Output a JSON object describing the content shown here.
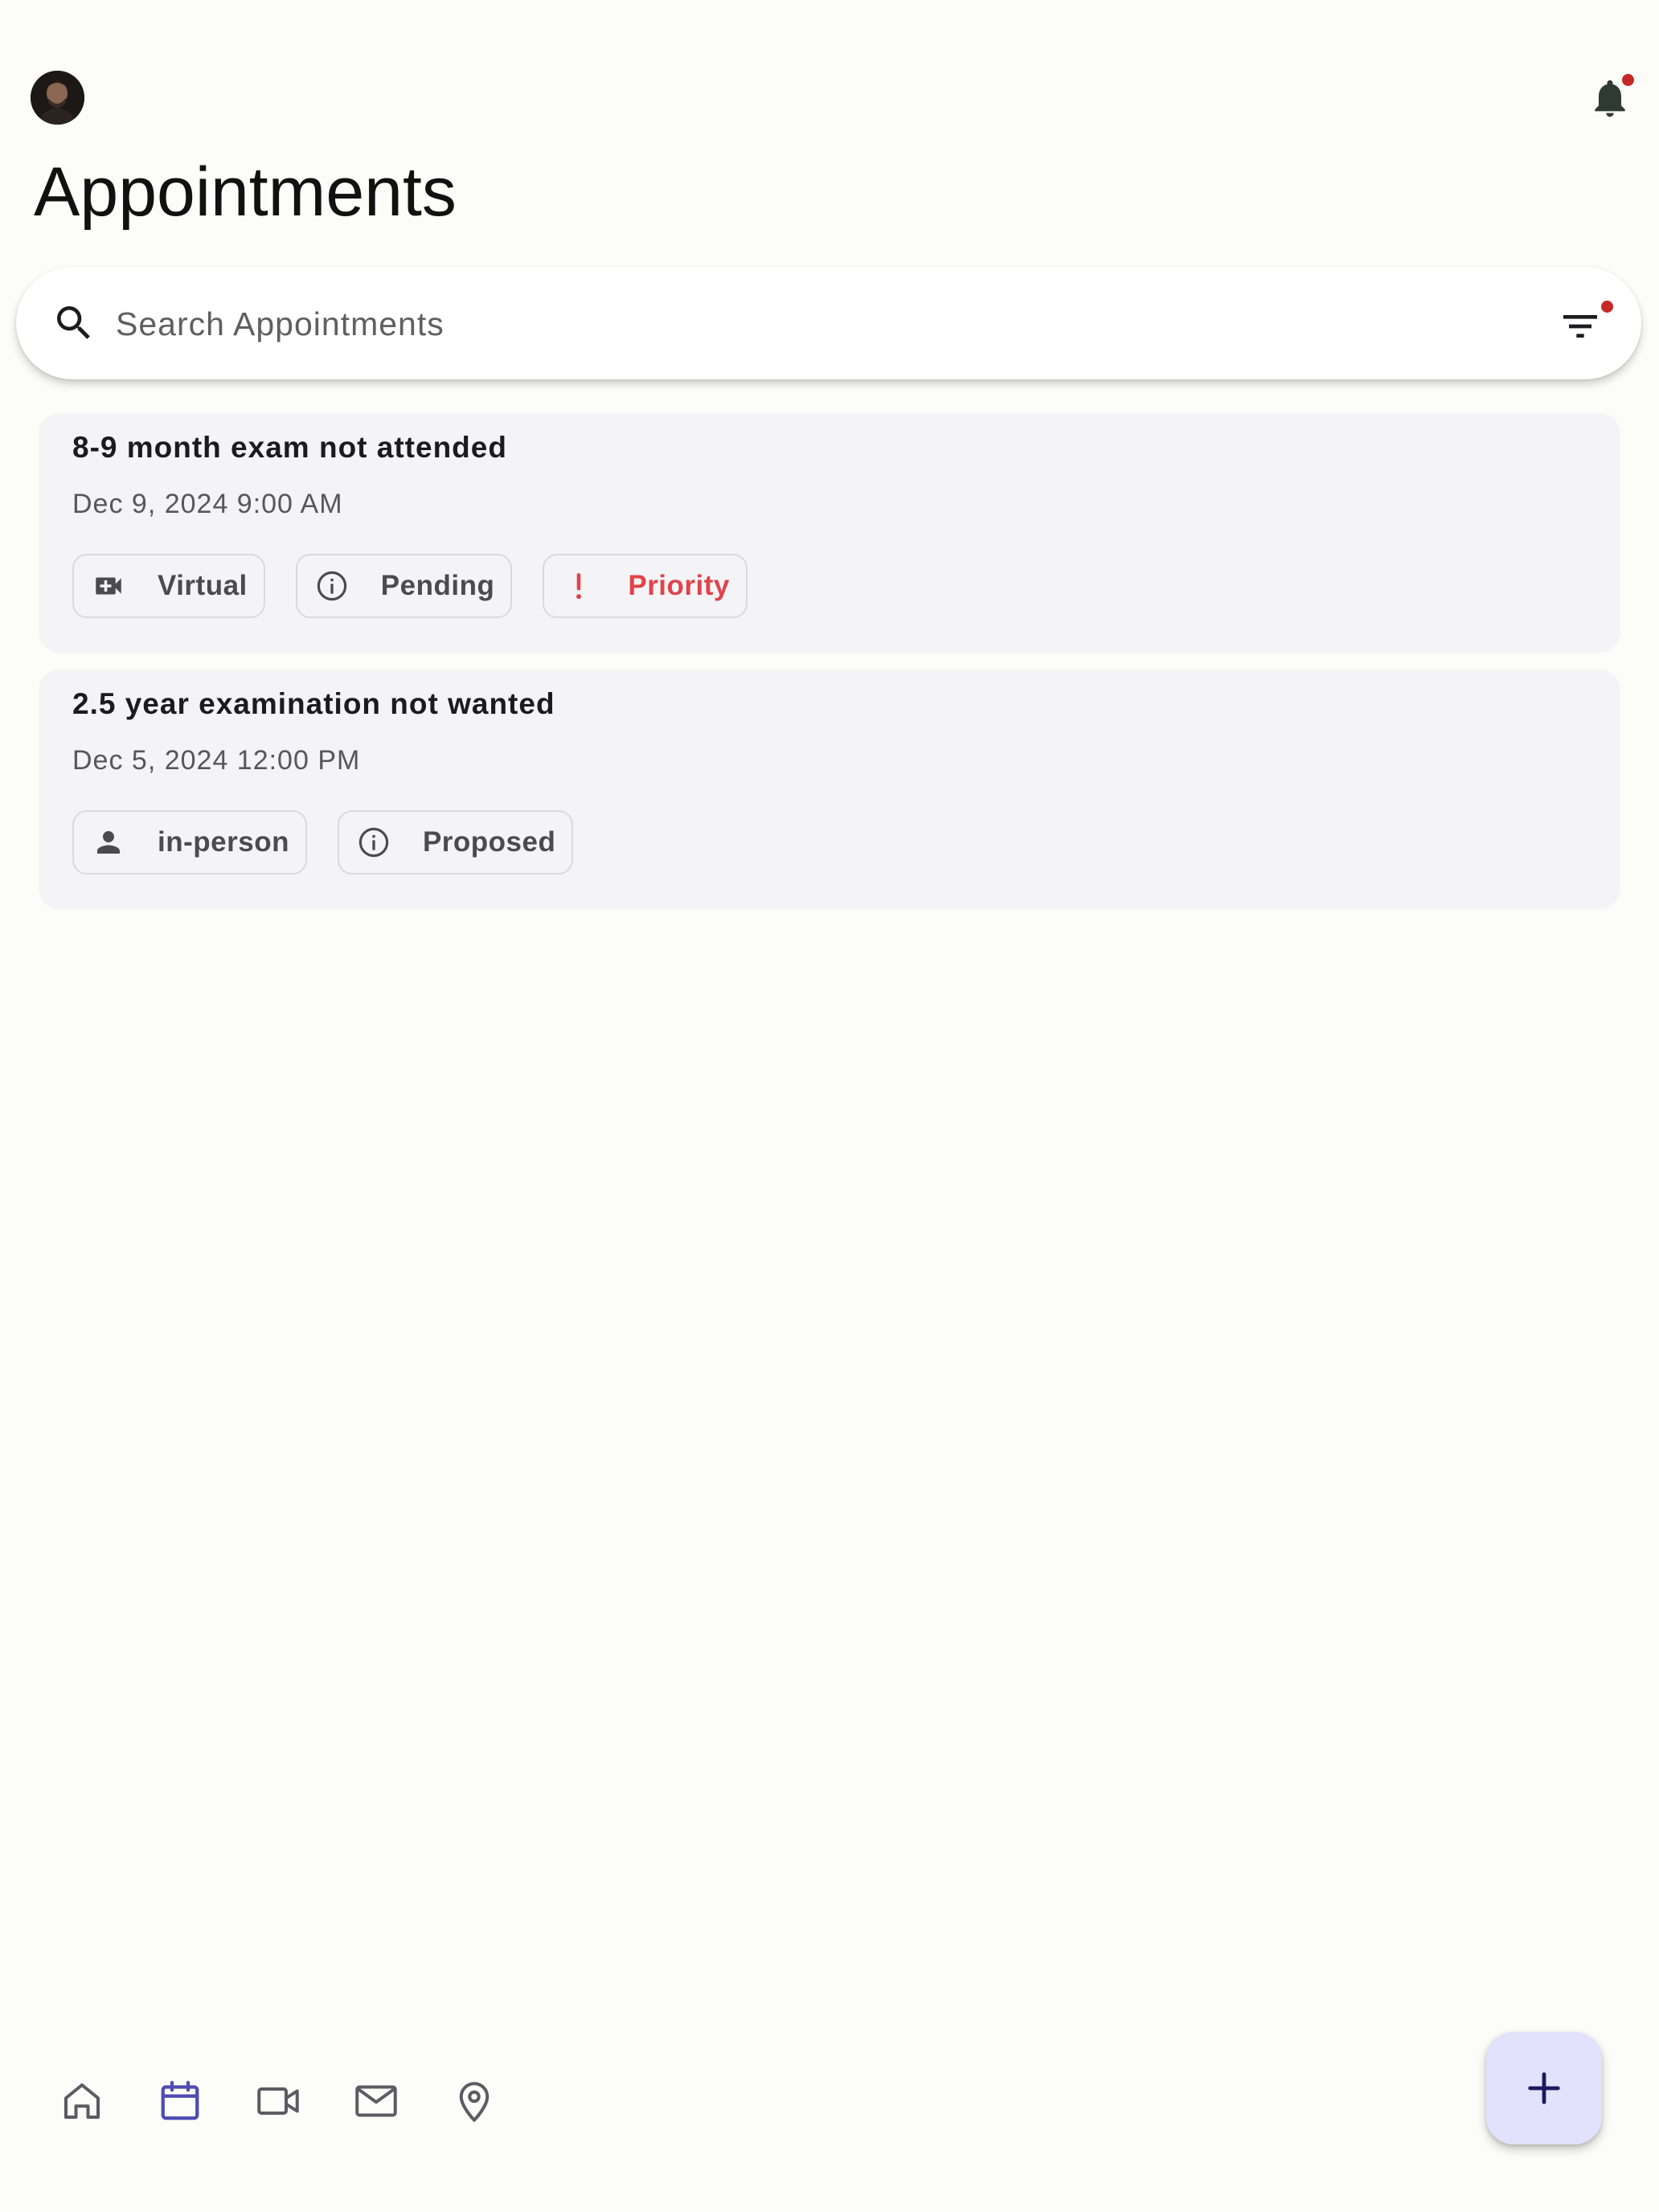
{
  "header": {
    "title": "Appointments",
    "avatar": "user-avatar",
    "notification_icon": "bell-icon",
    "notification_badge_color": "#c62828"
  },
  "search": {
    "placeholder": "Search Appointments",
    "value": "",
    "icon": "search-icon",
    "filter_icon": "filter-icon"
  },
  "appointments": [
    {
      "title": "8-9 month exam not attended",
      "datetime": "Dec 9, 2024 9:00 AM",
      "chips": [
        {
          "label": "Virtual",
          "icon": "video-camera-icon"
        },
        {
          "label": "Pending",
          "icon": "info-icon"
        },
        {
          "label": "Priority",
          "icon": "exclamation-icon",
          "color": "#e0434b"
        }
      ]
    },
    {
      "title": "2.5 year examination not wanted",
      "datetime": "Dec 5, 2024 12:00 PM",
      "chips": [
        {
          "label": "in-person",
          "icon": "person-icon"
        },
        {
          "label": "Proposed",
          "icon": "info-icon"
        }
      ]
    }
  ],
  "bottom_nav": {
    "items": [
      "home-icon",
      "calendar-icon",
      "video-icon",
      "mail-icon",
      "location-pin-icon"
    ],
    "active": "calendar-icon",
    "active_color": "#4f4bb3"
  },
  "fab": {
    "icon": "plus-icon",
    "color": "#e3e2fd"
  }
}
